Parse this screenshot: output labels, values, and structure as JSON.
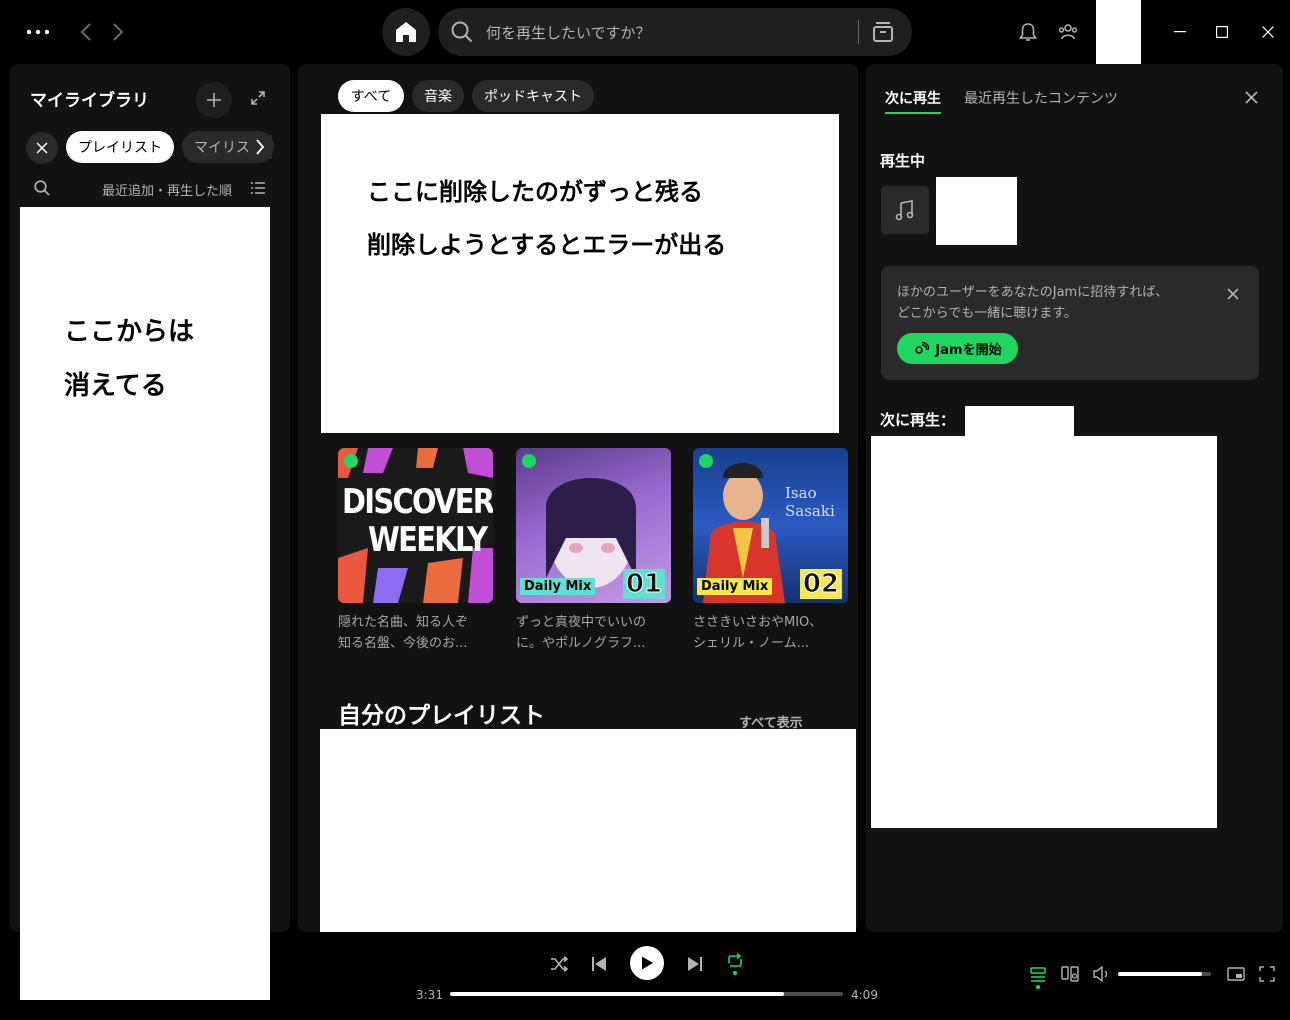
{
  "topbar": {
    "search_placeholder": "何を再生したいですか？"
  },
  "library": {
    "title": "マイライブラリ",
    "chips": [
      "プレイリスト",
      "マイリスト"
    ],
    "sort_label": "最近追加・再生した順",
    "annotation": [
      "ここからは",
      "消えてる"
    ]
  },
  "main": {
    "filters": [
      "すべて",
      "音楽",
      "ポッドキャスト"
    ],
    "annotation": [
      "ここに削除したのがずっと残る",
      "削除しようとするとエラーが出る"
    ],
    "tiles": [
      {
        "cover_text": [
          "DISCOVER",
          "WEEKLY"
        ],
        "desc": [
          "隠れた名曲、知る人ぞ",
          "知る名盤、今後のお..."
        ]
      },
      {
        "badge": "Daily Mix",
        "num": "01",
        "desc": [
          "ずっと真夜中でいいの",
          "に。やポルノグラフ..."
        ]
      },
      {
        "badge": "Daily Mix",
        "num": "02",
        "cover_text": "Isao Sasaki",
        "desc": [
          "ささきいさおやMIO、",
          "シェリル・ノーム..."
        ]
      }
    ],
    "section_title": "自分のプレイリスト",
    "show_all": "すべて表示"
  },
  "queue": {
    "tab_active": "次に再生",
    "tab_recent": "最近再生したコンテンツ",
    "now_playing": "再生中",
    "jam_text": [
      "ほかのユーザーをあなたのJamに招待すれば、",
      "どこからでも一緒に聴けます。"
    ],
    "jam_button": "Jamを開始",
    "next_label": "次に再生："
  },
  "player": {
    "elapsed": "3:31",
    "duration": "4:09",
    "progress": 0.85,
    "volume": 0.9
  },
  "colors": {
    "accent": "#1ed760",
    "bg": "#000000",
    "panel": "#121212"
  }
}
